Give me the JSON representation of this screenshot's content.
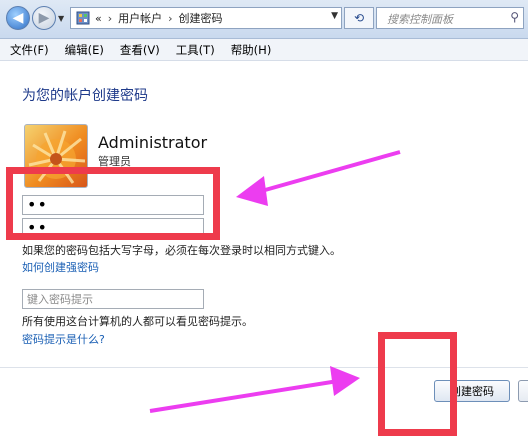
{
  "window": {
    "address": {
      "overflow": "«",
      "crumbs": [
        "用户帐户",
        "创建密码"
      ]
    },
    "search": {
      "placeholder": "搜索控制面板"
    }
  },
  "menu": [
    "文件(F)",
    "编辑(E)",
    "查看(V)",
    "工具(T)",
    "帮助(H)"
  ],
  "page": {
    "title": "为您的帐户创建密码",
    "user": {
      "name": "Administrator",
      "role": "管理员"
    },
    "password": "••",
    "confirm": "••",
    "case_note": "如果您的密码包括大写字母，必须在每次登录时以相同方式键入。",
    "strong_link": "如何创建强密码",
    "hint_placeholder": "键入密码提示",
    "hint_note": "所有使用这台计算机的人都可以看见密码提示。",
    "hint_link": "密码提示是什么?",
    "create_button": "创建密码"
  },
  "colors": {
    "annotation_box": "#ee3b4c",
    "annotation_arrow": "#ec3df0",
    "link": "#1a5fb4",
    "title": "#1e3a8a"
  },
  "icons": [
    "back-icon",
    "forward-icon",
    "control-panel-icon",
    "refresh-icon",
    "search-icon",
    "user-avatar-icon"
  ]
}
